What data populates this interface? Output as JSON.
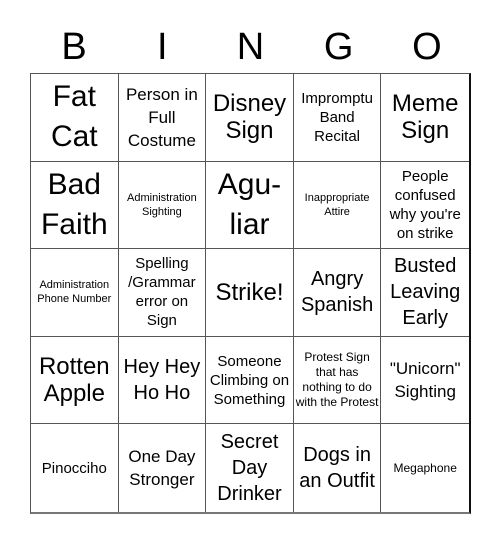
{
  "header": {
    "letters": [
      "B",
      "I",
      "N",
      "G",
      "O"
    ]
  },
  "cells": [
    "Fat Cat",
    "Person in Full Costume",
    "Disney Sign",
    "Impromptu Band Recital",
    "Meme Sign",
    "Bad Faith",
    "Administration Sighting",
    "Agu-liar",
    "Inappropriate Attire",
    "People confused why you're on strike",
    "Administration Phone Number",
    "Spelling /Grammar error on Sign",
    "Strike!",
    "Angry Spanish",
    "Busted Leaving Early",
    "Rotten Apple",
    "Hey Hey Ho Ho",
    "Someone Climbing on Something",
    "Protest Sign that has nothing to do with the Protest",
    "\"Unicorn\" Sighting",
    "Pinocciho",
    "One Day Stronger",
    "Secret Day Drinker",
    "Dogs in an Outfit",
    "Megaphone"
  ]
}
